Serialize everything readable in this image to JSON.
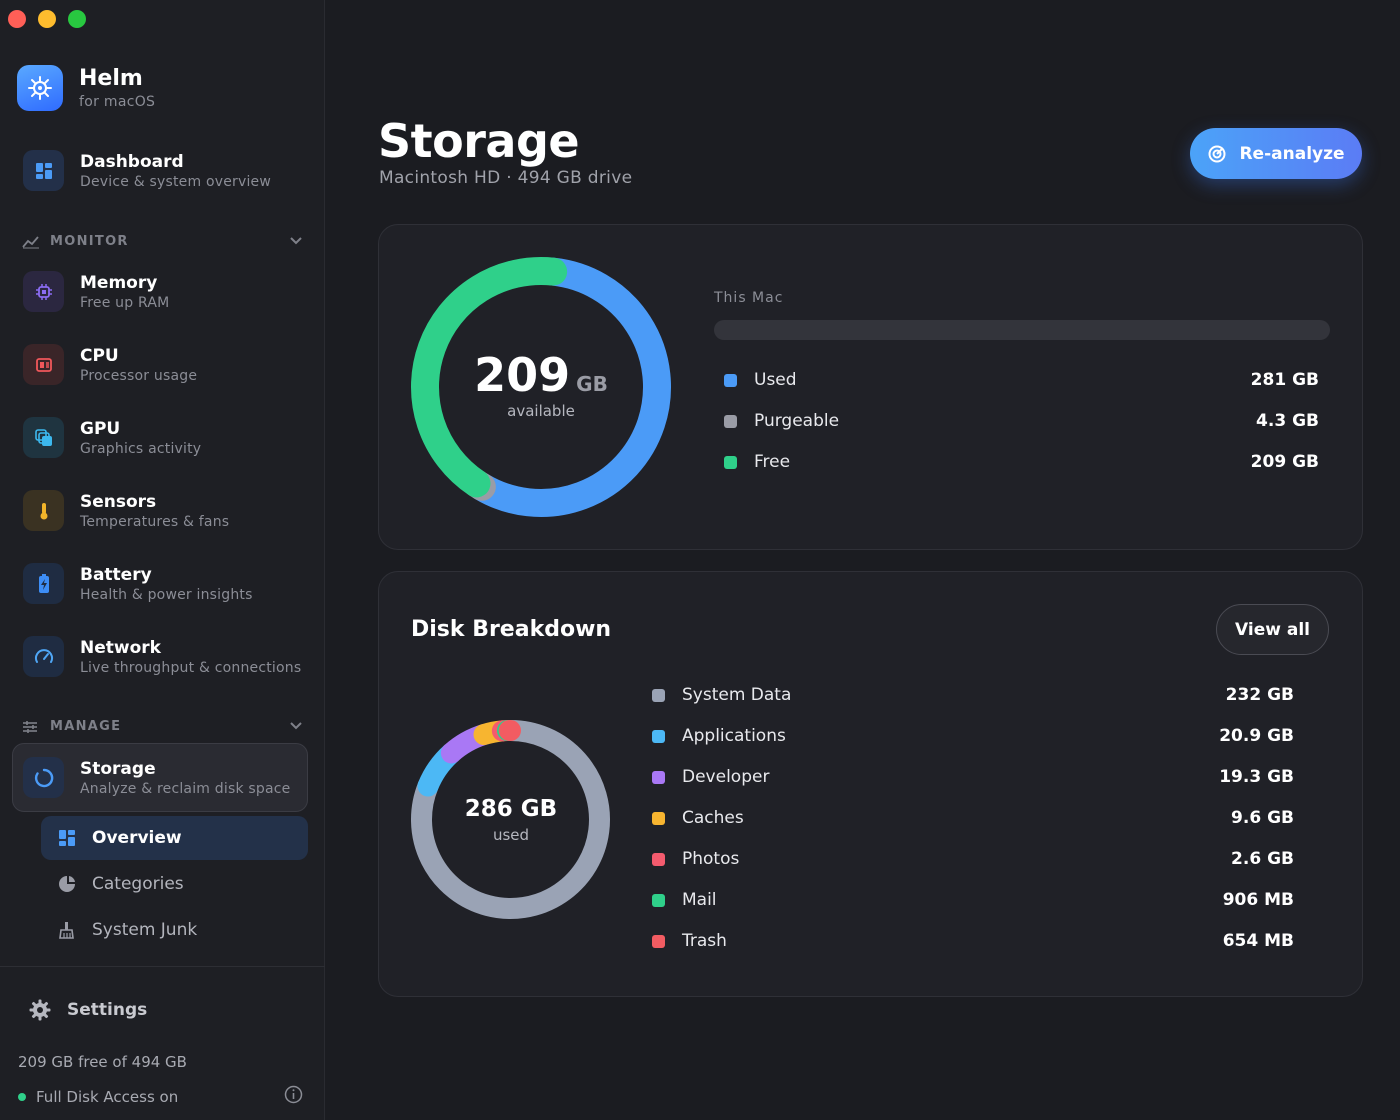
{
  "app": {
    "name": "Helm",
    "subtitle": "for macOS"
  },
  "sidebar": {
    "dashboard": {
      "title": "Dashboard",
      "sub": "Device & system overview"
    },
    "monitor_header": "MONITOR",
    "monitor_items": [
      {
        "title": "Memory",
        "sub": "Free up RAM",
        "icon": "chip-icon",
        "color": "#8b6cf2"
      },
      {
        "title": "CPU",
        "sub": "Processor usage",
        "icon": "processor-icon",
        "color": "#f0575a"
      },
      {
        "title": "GPU",
        "sub": "Graphics activity",
        "icon": "layers-icon",
        "color": "#3cb8ee"
      },
      {
        "title": "Sensors",
        "sub": "Temperatures & fans",
        "icon": "thermometer-icon",
        "color": "#f2b52a"
      },
      {
        "title": "Battery",
        "sub": "Health & power insights",
        "icon": "battery-icon",
        "color": "#3d8df5"
      },
      {
        "title": "Network",
        "sub": "Live throughput & connections",
        "icon": "gauge-icon",
        "color": "#4fa6f5"
      }
    ],
    "manage_header": "MANAGE",
    "storage": {
      "title": "Storage",
      "sub": "Analyze & reclaim disk space"
    },
    "storage_sub": [
      {
        "label": "Overview",
        "icon": "grid-icon"
      },
      {
        "label": "Categories",
        "icon": "pie-icon"
      },
      {
        "label": "System Junk",
        "icon": "broom-icon"
      }
    ],
    "settings": "Settings",
    "free_text": "209 GB free of 494 GB",
    "access_text": "Full Disk Access on"
  },
  "header": {
    "title": "Storage",
    "subtitle": "Macintosh HD · 494 GB drive",
    "reanalyze": "Re-analyze"
  },
  "summary": {
    "available_value": "209",
    "available_unit": "GB",
    "available_label": "available",
    "section_label": "This Mac",
    "legend": [
      {
        "name": "Used",
        "value": "281 GB",
        "color": "#4b9bf7"
      },
      {
        "name": "Purgeable",
        "value": "4.3 GB",
        "color": "#9a9ca6"
      },
      {
        "name": "Free",
        "value": "209 GB",
        "color": "#2fd08a"
      }
    ]
  },
  "breakdown": {
    "title": "Disk Breakdown",
    "view_all": "View all",
    "used_value": "286 GB",
    "used_label": "used",
    "items": [
      {
        "name": "System Data",
        "value": "232 GB",
        "color": "#9aa3b5"
      },
      {
        "name": "Applications",
        "value": "20.9 GB",
        "color": "#4cb8f5"
      },
      {
        "name": "Developer",
        "value": "19.3 GB",
        "color": "#a978f5"
      },
      {
        "name": "Caches",
        "value": "9.6 GB",
        "color": "#f7b530"
      },
      {
        "name": "Photos",
        "value": "2.6 GB",
        "color": "#f45b6e"
      },
      {
        "name": "Mail",
        "value": "906 MB",
        "color": "#2fd08a"
      },
      {
        "name": "Trash",
        "value": "654 MB",
        "color": "#f25c62"
      }
    ]
  },
  "chart_data": [
    {
      "type": "pie",
      "categories": [
        "Used",
        "Purgeable",
        "Free"
      ],
      "values": [
        281,
        4.3,
        209
      ],
      "unit": "GB"
    },
    {
      "type": "pie",
      "categories": [
        "System Data",
        "Applications",
        "Developer",
        "Caches",
        "Photos",
        "Mail",
        "Trash"
      ],
      "values": [
        232,
        20.9,
        19.3,
        9.6,
        2.6,
        0.906,
        0.654
      ],
      "unit": "GB"
    }
  ]
}
